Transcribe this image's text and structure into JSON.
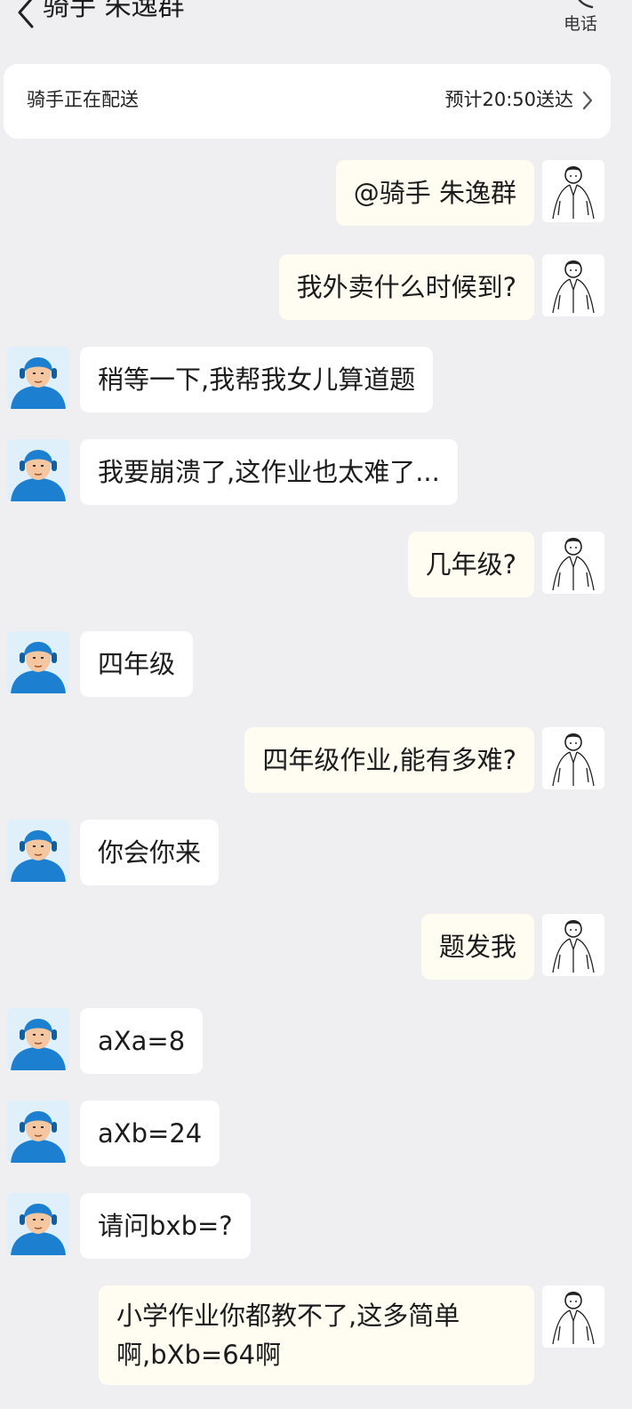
{
  "header": {
    "title": "骑手 朱逸群",
    "call_label": "电话"
  },
  "status": {
    "left": "骑手正在配送",
    "right": "预计20:50送达"
  },
  "messages": [
    {
      "from": "me",
      "text": "@骑手 朱逸群"
    },
    {
      "from": "me",
      "text": "我外卖什么时候到?"
    },
    {
      "from": "rider",
      "text": "稍等一下,我帮我女儿算道题"
    },
    {
      "from": "rider",
      "text": "我要崩溃了,这作业也太难了..."
    },
    {
      "from": "me",
      "text": "几年级?"
    },
    {
      "from": "rider",
      "text": "四年级"
    },
    {
      "from": "me",
      "text": "四年级作业,能有多难?"
    },
    {
      "from": "rider",
      "text": "你会你来"
    },
    {
      "from": "me",
      "text": "题发我"
    },
    {
      "from": "rider",
      "text": "aXa=8"
    },
    {
      "from": "rider",
      "text": "aXb=24"
    },
    {
      "from": "rider",
      "text": "请问bxb=?"
    },
    {
      "from": "me",
      "text": "小学作业你都教不了,这多简单啊,bXb=64啊"
    }
  ],
  "colors": {
    "background": "#efeff1",
    "rider_blue": "#1d7fd0",
    "my_bubble": "#fffcf1"
  }
}
